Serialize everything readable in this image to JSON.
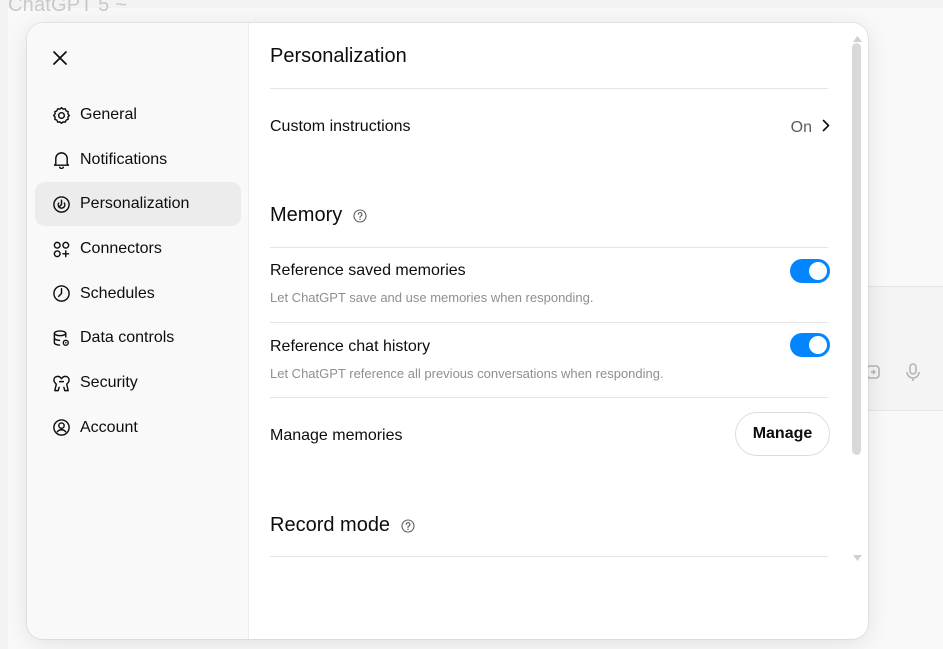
{
  "background": {
    "title": "ChatGPT 5 ~"
  },
  "sidebar": {
    "items": [
      {
        "label": "General",
        "icon": "gear-icon"
      },
      {
        "label": "Notifications",
        "icon": "bell-icon"
      },
      {
        "label": "Personalization",
        "icon": "personalization-icon",
        "active": true
      },
      {
        "label": "Connectors",
        "icon": "connectors-icon"
      },
      {
        "label": "Schedules",
        "icon": "clock-icon"
      },
      {
        "label": "Data controls",
        "icon": "database-icon"
      },
      {
        "label": "Security",
        "icon": "shield-icon"
      },
      {
        "label": "Account",
        "icon": "account-icon"
      }
    ]
  },
  "main": {
    "title": "Personalization",
    "custom_instructions": {
      "label": "Custom instructions",
      "value": "On"
    },
    "memory": {
      "title": "Memory",
      "reference_saved": {
        "label": "Reference saved memories",
        "description": "Let ChatGPT save and use memories when responding.",
        "enabled": true
      },
      "reference_history": {
        "label": "Reference chat history",
        "description": "Let ChatGPT reference all previous conversations when responding.",
        "enabled": true
      },
      "manage": {
        "label": "Manage memories",
        "button": "Manage"
      }
    },
    "record_mode": {
      "title": "Record mode"
    }
  },
  "colors": {
    "accent": "#0285ff",
    "active_nav_bg": "#ececec",
    "sidebar_bg": "#f9f9f9"
  }
}
